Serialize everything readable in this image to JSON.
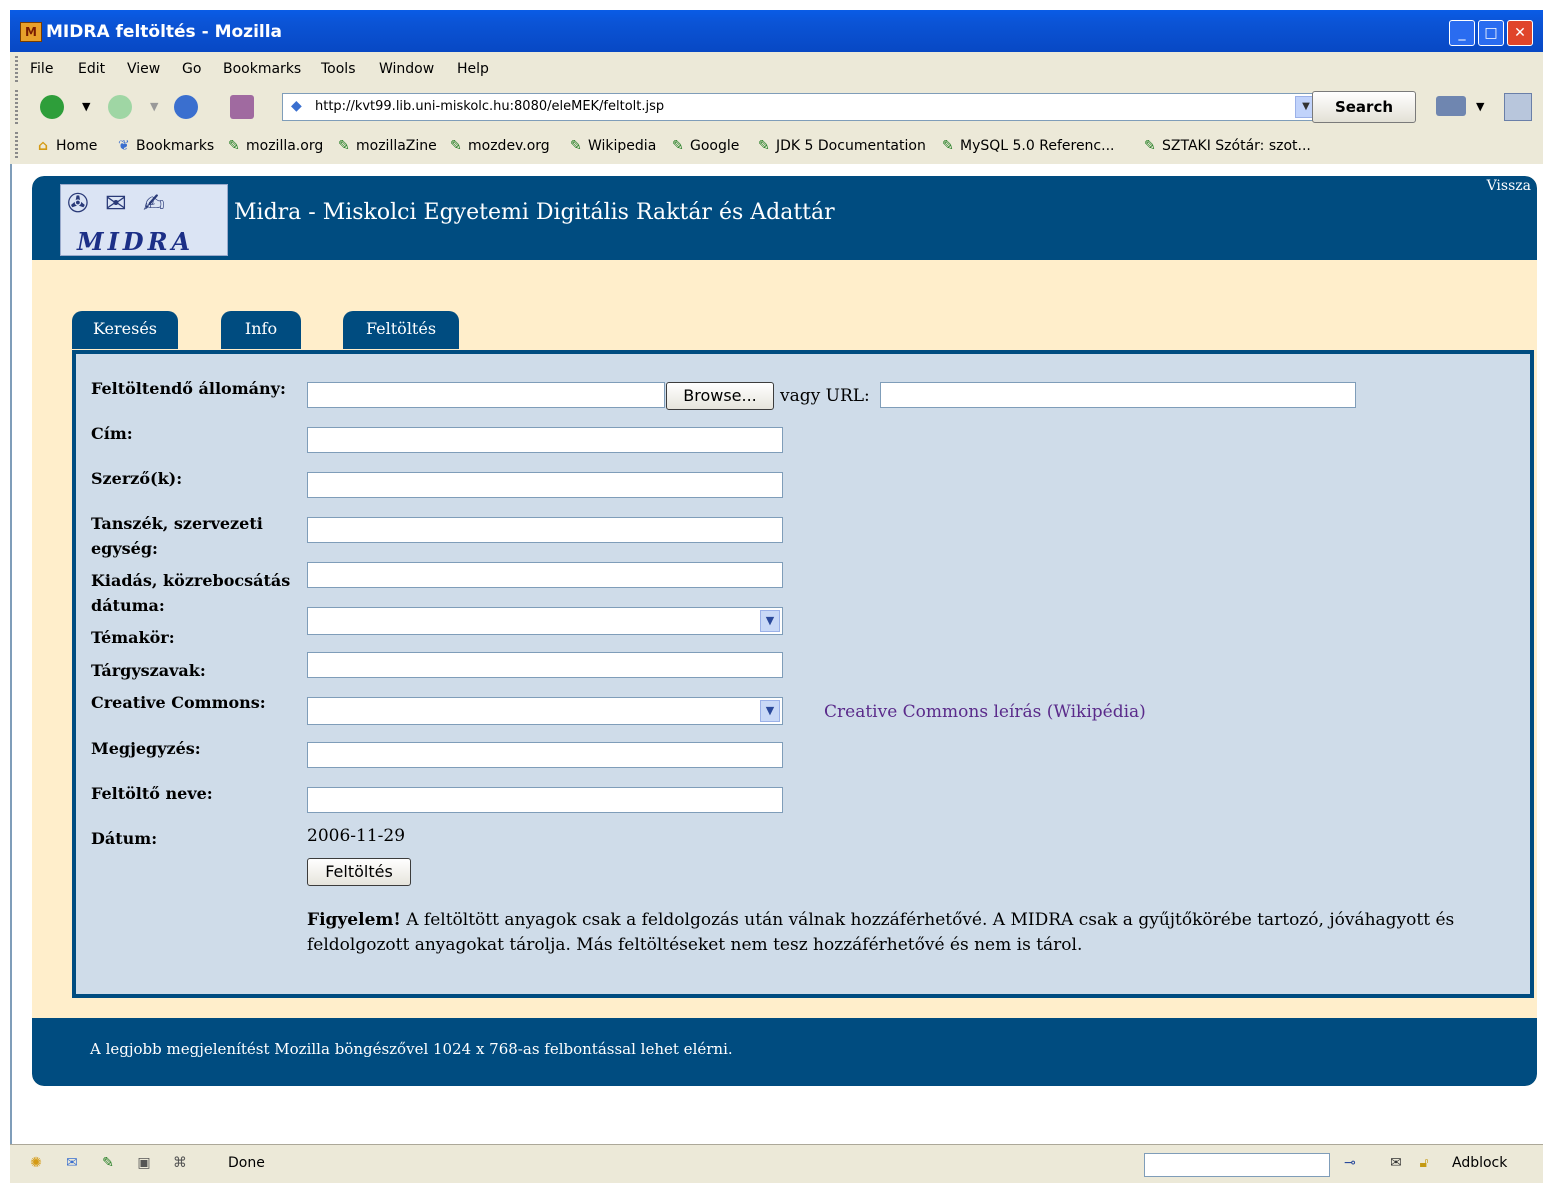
{
  "window": {
    "title": "MIDRA feltöltés - Mozilla"
  },
  "menu": [
    "File",
    "Edit",
    "View",
    "Go",
    "Bookmarks",
    "Tools",
    "Window",
    "Help"
  ],
  "nav": {
    "url": "http://kvt99.lib.uni-miskolc.hu:8080/eleMEK/feltolt.jsp",
    "search_label": "Search"
  },
  "bookmarks": [
    "Home",
    "Bookmarks",
    "mozilla.org",
    "mozillaZine",
    "mozdev.org",
    "Wikipedia",
    "Google",
    "JDK 5 Documentation",
    "MySQL 5.0 Referenc...",
    "SZTAKI Szótár: szot..."
  ],
  "site": {
    "logo_text": "MIDRA",
    "title": "Midra - Miskolci Egyetemi Digitális Raktár és Adattár",
    "back_link": "Vissza",
    "tabs": [
      "Keresés",
      "Info",
      "Feltöltés"
    ],
    "footer": "A legjobb megjelenítést Mozilla böngészővel 1024 x 768-as felbontással lehet elérni."
  },
  "form": {
    "file_label": "Feltöltendő állomány:",
    "browse_label": "Browse...",
    "url_label": "vagy URL:",
    "title_label": "Cím:",
    "author_label": "Szerző(k):",
    "dept_label_1": "Tanszék, szervezeti",
    "dept_label_2": "egység:",
    "pubdate_label_1": "Kiadás, közrebocsátás",
    "pubdate_label_2": "dátuma:",
    "topic_label": "Témakör:",
    "keywords_label": "Tárgyszavak:",
    "cc_label": "Creative Commons:",
    "cc_link": "Creative Commons leírás (Wikipédia)",
    "note_label": "Megjegyzés:",
    "uploader_label": "Feltöltő neve:",
    "date_label": "Dátum:",
    "date_value": "2006-11-29",
    "submit_label": "Feltöltés",
    "warning_bold": "Figyelem!",
    "warning_line1": " A feltöltött anyagok csak a feldolgozás után válnak hozzáférhetővé. A MIDRA csak a gyűjtőkörébe tartozó, jóváhagyott és",
    "warning_line2": "feldolgozott anyagokat tárolja. Más feltöltéseket nem tesz hozzáférhetővé és nem is tárol."
  },
  "status": {
    "text": "Done",
    "adblock": "Adblock"
  }
}
